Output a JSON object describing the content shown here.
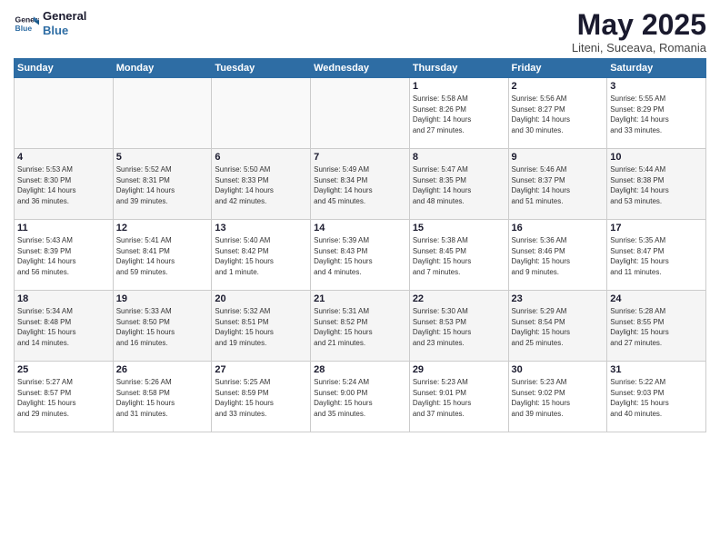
{
  "logo": {
    "line1": "General",
    "line2": "Blue"
  },
  "title": "May 2025",
  "subtitle": "Liteni, Suceava, Romania",
  "days_header": [
    "Sunday",
    "Monday",
    "Tuesday",
    "Wednesday",
    "Thursday",
    "Friday",
    "Saturday"
  ],
  "weeks": [
    [
      {
        "num": "",
        "info": ""
      },
      {
        "num": "",
        "info": ""
      },
      {
        "num": "",
        "info": ""
      },
      {
        "num": "",
        "info": ""
      },
      {
        "num": "1",
        "info": "Sunrise: 5:58 AM\nSunset: 8:26 PM\nDaylight: 14 hours\nand 27 minutes."
      },
      {
        "num": "2",
        "info": "Sunrise: 5:56 AM\nSunset: 8:27 PM\nDaylight: 14 hours\nand 30 minutes."
      },
      {
        "num": "3",
        "info": "Sunrise: 5:55 AM\nSunset: 8:29 PM\nDaylight: 14 hours\nand 33 minutes."
      }
    ],
    [
      {
        "num": "4",
        "info": "Sunrise: 5:53 AM\nSunset: 8:30 PM\nDaylight: 14 hours\nand 36 minutes."
      },
      {
        "num": "5",
        "info": "Sunrise: 5:52 AM\nSunset: 8:31 PM\nDaylight: 14 hours\nand 39 minutes."
      },
      {
        "num": "6",
        "info": "Sunrise: 5:50 AM\nSunset: 8:33 PM\nDaylight: 14 hours\nand 42 minutes."
      },
      {
        "num": "7",
        "info": "Sunrise: 5:49 AM\nSunset: 8:34 PM\nDaylight: 14 hours\nand 45 minutes."
      },
      {
        "num": "8",
        "info": "Sunrise: 5:47 AM\nSunset: 8:35 PM\nDaylight: 14 hours\nand 48 minutes."
      },
      {
        "num": "9",
        "info": "Sunrise: 5:46 AM\nSunset: 8:37 PM\nDaylight: 14 hours\nand 51 minutes."
      },
      {
        "num": "10",
        "info": "Sunrise: 5:44 AM\nSunset: 8:38 PM\nDaylight: 14 hours\nand 53 minutes."
      }
    ],
    [
      {
        "num": "11",
        "info": "Sunrise: 5:43 AM\nSunset: 8:39 PM\nDaylight: 14 hours\nand 56 minutes."
      },
      {
        "num": "12",
        "info": "Sunrise: 5:41 AM\nSunset: 8:41 PM\nDaylight: 14 hours\nand 59 minutes."
      },
      {
        "num": "13",
        "info": "Sunrise: 5:40 AM\nSunset: 8:42 PM\nDaylight: 15 hours\nand 1 minute."
      },
      {
        "num": "14",
        "info": "Sunrise: 5:39 AM\nSunset: 8:43 PM\nDaylight: 15 hours\nand 4 minutes."
      },
      {
        "num": "15",
        "info": "Sunrise: 5:38 AM\nSunset: 8:45 PM\nDaylight: 15 hours\nand 7 minutes."
      },
      {
        "num": "16",
        "info": "Sunrise: 5:36 AM\nSunset: 8:46 PM\nDaylight: 15 hours\nand 9 minutes."
      },
      {
        "num": "17",
        "info": "Sunrise: 5:35 AM\nSunset: 8:47 PM\nDaylight: 15 hours\nand 11 minutes."
      }
    ],
    [
      {
        "num": "18",
        "info": "Sunrise: 5:34 AM\nSunset: 8:48 PM\nDaylight: 15 hours\nand 14 minutes."
      },
      {
        "num": "19",
        "info": "Sunrise: 5:33 AM\nSunset: 8:50 PM\nDaylight: 15 hours\nand 16 minutes."
      },
      {
        "num": "20",
        "info": "Sunrise: 5:32 AM\nSunset: 8:51 PM\nDaylight: 15 hours\nand 19 minutes."
      },
      {
        "num": "21",
        "info": "Sunrise: 5:31 AM\nSunset: 8:52 PM\nDaylight: 15 hours\nand 21 minutes."
      },
      {
        "num": "22",
        "info": "Sunrise: 5:30 AM\nSunset: 8:53 PM\nDaylight: 15 hours\nand 23 minutes."
      },
      {
        "num": "23",
        "info": "Sunrise: 5:29 AM\nSunset: 8:54 PM\nDaylight: 15 hours\nand 25 minutes."
      },
      {
        "num": "24",
        "info": "Sunrise: 5:28 AM\nSunset: 8:55 PM\nDaylight: 15 hours\nand 27 minutes."
      }
    ],
    [
      {
        "num": "25",
        "info": "Sunrise: 5:27 AM\nSunset: 8:57 PM\nDaylight: 15 hours\nand 29 minutes."
      },
      {
        "num": "26",
        "info": "Sunrise: 5:26 AM\nSunset: 8:58 PM\nDaylight: 15 hours\nand 31 minutes."
      },
      {
        "num": "27",
        "info": "Sunrise: 5:25 AM\nSunset: 8:59 PM\nDaylight: 15 hours\nand 33 minutes."
      },
      {
        "num": "28",
        "info": "Sunrise: 5:24 AM\nSunset: 9:00 PM\nDaylight: 15 hours\nand 35 minutes."
      },
      {
        "num": "29",
        "info": "Sunrise: 5:23 AM\nSunset: 9:01 PM\nDaylight: 15 hours\nand 37 minutes."
      },
      {
        "num": "30",
        "info": "Sunrise: 5:23 AM\nSunset: 9:02 PM\nDaylight: 15 hours\nand 39 minutes."
      },
      {
        "num": "31",
        "info": "Sunrise: 5:22 AM\nSunset: 9:03 PM\nDaylight: 15 hours\nand 40 minutes."
      }
    ]
  ]
}
